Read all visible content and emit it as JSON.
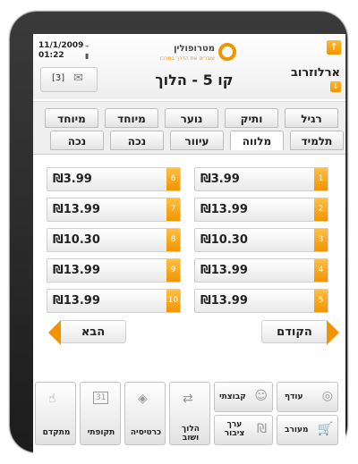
{
  "header": {
    "date": "11/1/2009",
    "time": "01:22",
    "city": "ארלוזרוב",
    "title": "קו 5 - הלוך",
    "logo_name": "מטרופולין",
    "logo_tagline": "עוברים את הדרך במרכז",
    "message_count": "[3]"
  },
  "tabs_row1": [
    "רגיל",
    "ותיק",
    "נוער",
    "מיוחד",
    "מיוחד"
  ],
  "tabs_row2": [
    "תלמיד",
    "מלווה",
    "עיוור",
    "נכה",
    "נכה"
  ],
  "active_tab": "מלווה",
  "prices_right": [
    {
      "n": "1",
      "price": "₪3.99"
    },
    {
      "n": "2",
      "price": "₪13.99"
    },
    {
      "n": "3",
      "price": "₪10.30"
    },
    {
      "n": "4",
      "price": "₪13.99"
    },
    {
      "n": "5",
      "price": "₪13.99"
    }
  ],
  "prices_left": [
    {
      "n": "6",
      "price": "₪3.99"
    },
    {
      "n": "7",
      "price": "₪13.99"
    },
    {
      "n": "8",
      "price": "₪10.30"
    },
    {
      "n": "9",
      "price": "₪13.99"
    },
    {
      "n": "10",
      "price": "₪13.99"
    }
  ],
  "nav": {
    "prev": "הקודם",
    "next": "הבא"
  },
  "toolbar": {
    "surplus": "עודף",
    "groups": "קבוצתי",
    "mixed": "מעורב",
    "public_value": "ערך ציבור",
    "return_trip": "הלוך ושוב",
    "ticket_card": "כרטיסיה",
    "periodic": "תקופתי",
    "advanced": "מתקדם",
    "calendar_day": "31"
  },
  "colors": {
    "accent": "#f29400",
    "frame": "#1c1c1c"
  }
}
